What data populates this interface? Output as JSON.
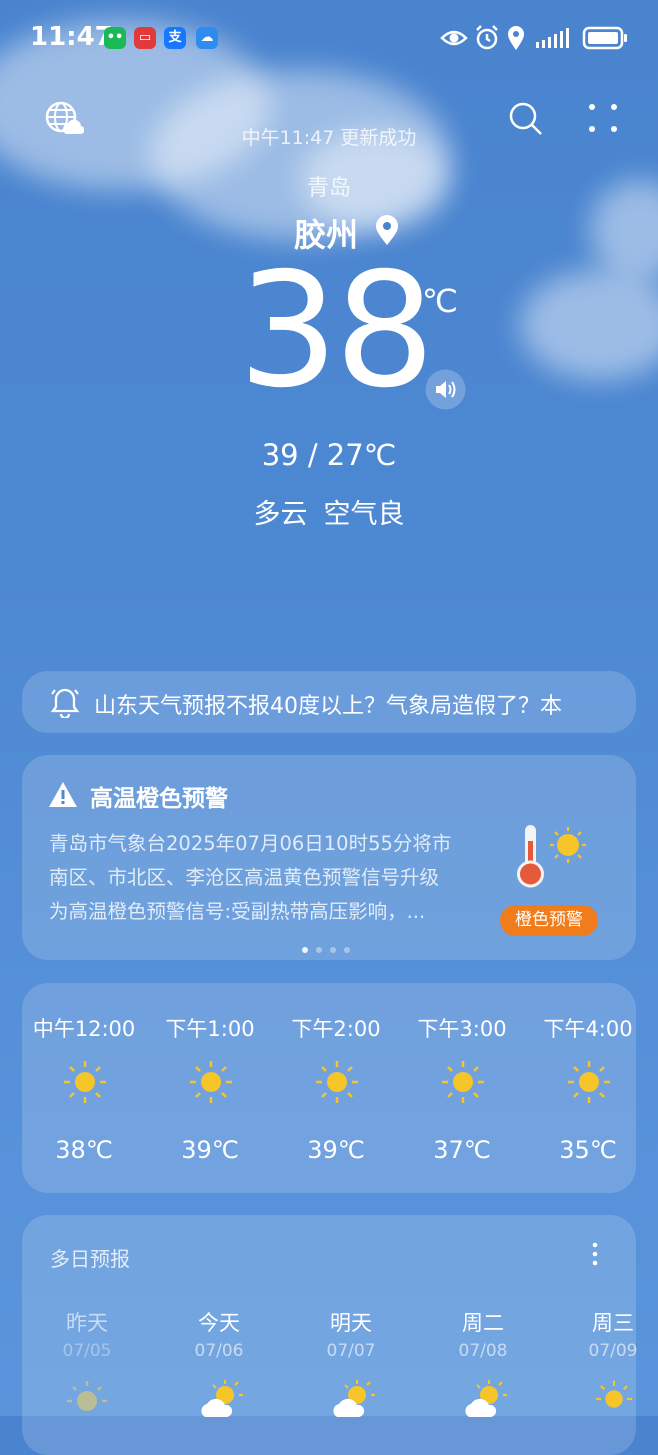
{
  "status": {
    "time": "11:47",
    "apps": [
      {
        "name": "wechat",
        "color": "#19b955",
        "glyph": "••"
      },
      {
        "name": "red-app",
        "color": "#e23a3a",
        "glyph": "▭"
      },
      {
        "name": "alipay",
        "color": "#1677ff",
        "glyph": "支"
      },
      {
        "name": "weather-app",
        "color": "#2e8cf0",
        "glyph": "☁"
      }
    ]
  },
  "header": {
    "update_text": "中午11:47 更新成功",
    "city": "青岛",
    "district": "胶州",
    "temp": "38",
    "unit": "℃",
    "range": "39 / 27℃",
    "condition": "多云",
    "air": "空气良"
  },
  "news": {
    "text": "山东天气预报不报40度以上？气象局造假了？本"
  },
  "alert": {
    "title": "高温橙色预警",
    "lines": [
      "青岛市气象台2025年07月06日10时55分将市",
      "南区、市北区、李沧区高温黄色预警信号升级",
      "为高温橙色预警信号:受副热带高压影响，..."
    ],
    "badge": "橙色预警",
    "badge_color": "#f07c1b",
    "active_page": 1,
    "pages": 4
  },
  "hourly": [
    {
      "label": "中午12:00",
      "icon": "sun-icon",
      "temp": "38℃"
    },
    {
      "label": "下午1:00",
      "icon": "sun-icon",
      "temp": "39℃"
    },
    {
      "label": "下午2:00",
      "icon": "sun-icon",
      "temp": "39℃"
    },
    {
      "label": "下午3:00",
      "icon": "sun-icon",
      "temp": "37℃"
    },
    {
      "label": "下午4:00",
      "icon": "sun-icon",
      "temp": "35℃"
    }
  ],
  "daily": {
    "title": "多日预报",
    "days": [
      {
        "name": "昨天",
        "date": "07/05",
        "icon": "sun-dim-icon"
      },
      {
        "name": "今天",
        "date": "07/06",
        "icon": "partly-cloudy-icon"
      },
      {
        "name": "明天",
        "date": "07/07",
        "icon": "partly-cloudy-icon"
      },
      {
        "name": "周二",
        "date": "07/08",
        "icon": "partly-cloudy-icon"
      },
      {
        "name": "周三",
        "date": "07/09",
        "icon": "sun-icon"
      }
    ]
  }
}
